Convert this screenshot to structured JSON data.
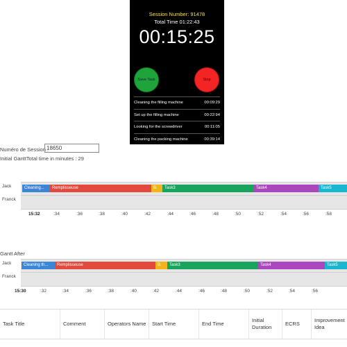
{
  "timer": {
    "session_number": "Session Number: 91478",
    "total_time": "Total Time 01:22:43",
    "clock": "00:15:25",
    "save_label": "Save Task",
    "stop_label": "Stop",
    "tasks": [
      {
        "name": "Cleaning the filling machine",
        "time": "00:09:29"
      },
      {
        "name": "Set up the filling machine",
        "time": "00:22:94"
      },
      {
        "name": "Looking for the screwdriver",
        "time": "00:11:05"
      },
      {
        "name": "Cleaning the packing machine",
        "time": "00:39:14"
      }
    ],
    "colors": {
      "save": "#1ea43a",
      "stop": "#f22424",
      "session_text": "#f2e34a"
    }
  },
  "session": {
    "label": "Numéro de Session :",
    "value": "18650",
    "total_minutes": "Initial GanttTotal time in minutes : 29"
  },
  "gantt_after_label": "Gantt After",
  "gantt_initial": {
    "rows": [
      {
        "name": "Jack",
        "bars": [
          {
            "label": "Cleaning...",
            "color": "#3d86d6"
          },
          {
            "label": "Remplisseuse",
            "color": "#e14a3d"
          },
          {
            "label": "B.",
            "color": "#f3b418"
          },
          {
            "label": "Task3",
            "color": "#19a45e"
          },
          {
            "label": "Task4",
            "color": "#ab47bc"
          },
          {
            "label": "Task5",
            "color": "#19b6cf"
          }
        ]
      },
      {
        "name": "Franck",
        "bars": []
      }
    ],
    "ticks": [
      "15:32",
      ":34",
      ":36",
      ":38",
      ":40",
      ":42",
      ":44",
      ":46",
      ":48",
      ":50",
      ":52",
      ":54",
      ":56",
      ":58"
    ]
  },
  "gantt_after": {
    "rows": [
      {
        "name": "Jack",
        "bars": [
          {
            "label": "Cleaning th...",
            "color": "#3d86d6"
          },
          {
            "label": "Remplisseuse",
            "color": "#e14a3d"
          },
          {
            "label": "B.",
            "color": "#f3b418"
          },
          {
            "label": "Task3",
            "color": "#19a45e"
          },
          {
            "label": "Task4",
            "color": "#ab47bc"
          },
          {
            "label": "Task5",
            "color": "#19b6cf"
          }
        ]
      },
      {
        "name": "Franck",
        "bars": []
      }
    ],
    "ticks": [
      "15:30",
      ":32",
      ":34",
      ":36",
      ":38",
      ":40",
      ":42",
      ":44",
      ":46",
      ":48",
      ":50",
      ":52",
      ":54",
      ":56"
    ]
  },
  "table": {
    "headers": [
      "Task Title",
      "Comment",
      "Operators Name",
      "Start Time",
      "End Time",
      "Initial Duration",
      "ECRS",
      "Improvement Idea"
    ]
  }
}
